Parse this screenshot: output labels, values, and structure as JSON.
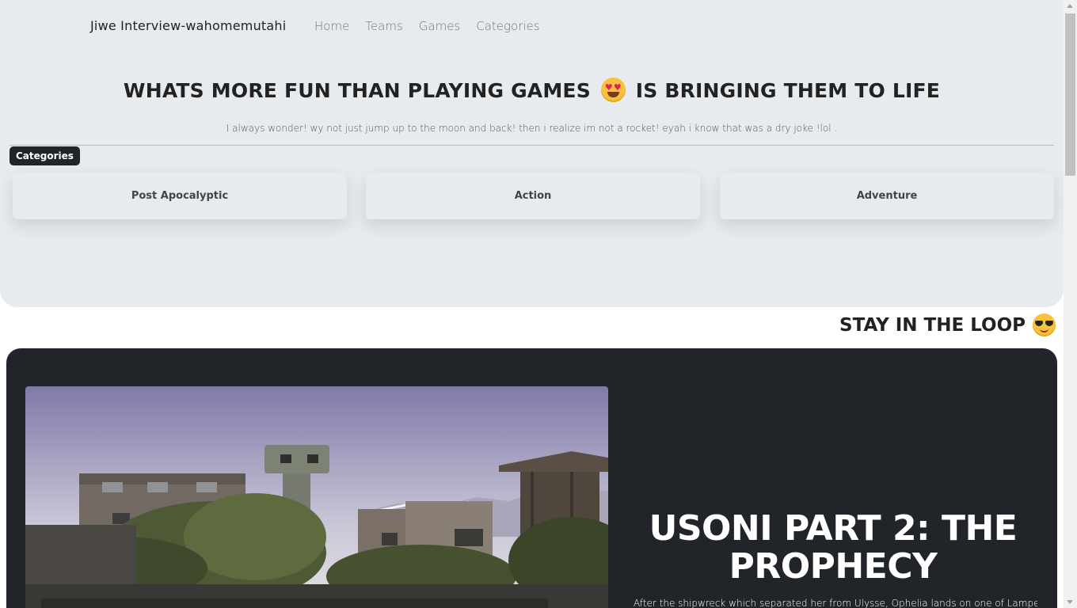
{
  "navbar": {
    "brand": "Jiwe Interview-wahomemutahi",
    "links": [
      "Home",
      "Teams",
      "Games",
      "Categories"
    ]
  },
  "hero": {
    "headline_part1": "WHATS MORE FUN THAN PLAYING GAMES",
    "headline_part2": "IS BRINGING THEM TO LIFE",
    "headline_emoji": "heart-eyes-emoji",
    "subline": "I always wonder! wy not just jump up to the moon and back! then i realize im not a rocket! eyah i know that was a dry joke !lol ."
  },
  "categories": {
    "badge": "Categories",
    "items": [
      "Post Apocalyptic",
      "Action",
      "Adventure"
    ]
  },
  "loop": {
    "title": "STAY IN THE LOOP",
    "emoji": "sunglasses-emoji"
  },
  "featured_game": {
    "title": "USONI PART 2: THE PROPHECY",
    "description": "After the shipwreck which separated her from Ulysse, Ophelia lands on one of Lampedusa",
    "image": "abandoned-buildings-with-water-tower"
  },
  "colors": {
    "hero_bg": "#e8ebee",
    "dark": "#212529",
    "badge_bg": "#212529",
    "nav_link": "#6c757d"
  }
}
